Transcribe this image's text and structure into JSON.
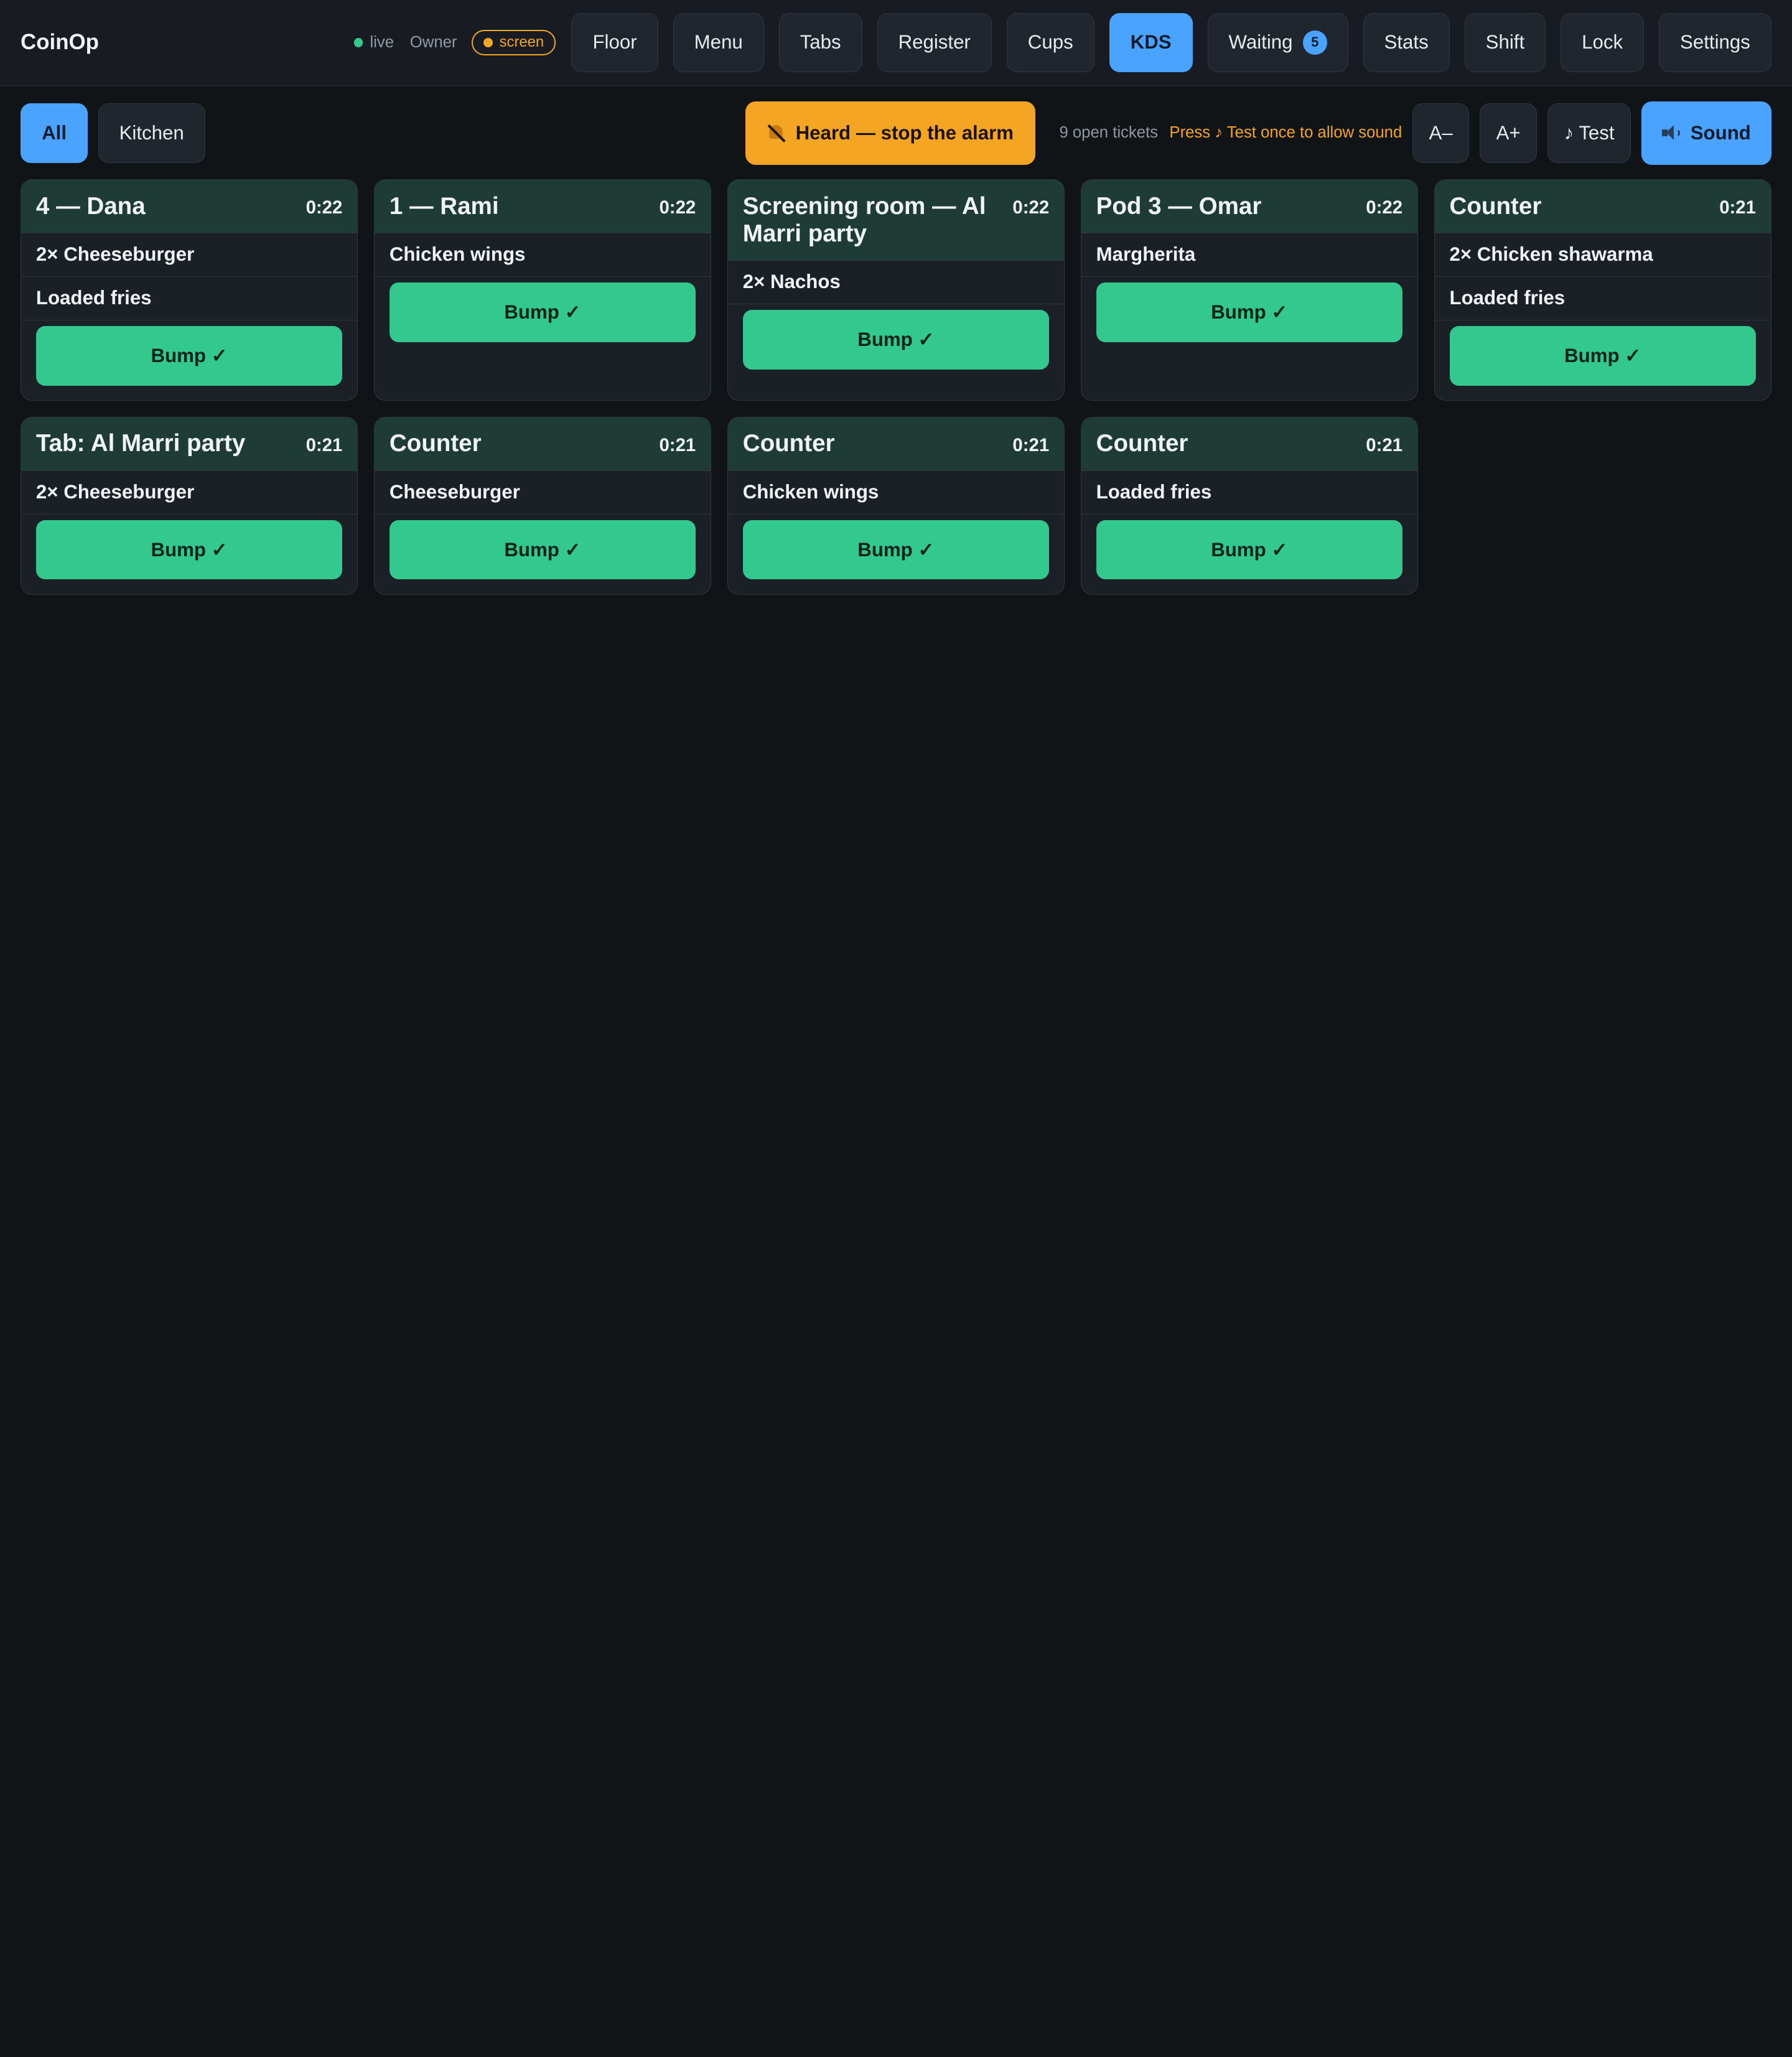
{
  "brand": "CoinOp",
  "status": {
    "live_label": "live",
    "role": "Owner",
    "mode_label": "screen"
  },
  "nav": [
    {
      "label": "Floor",
      "active": false
    },
    {
      "label": "Menu",
      "active": false
    },
    {
      "label": "Tabs",
      "active": false
    },
    {
      "label": "Register",
      "active": false
    },
    {
      "label": "Cups",
      "active": false
    },
    {
      "label": "KDS",
      "active": true
    },
    {
      "label": "Waiting",
      "active": false,
      "badge": "5"
    },
    {
      "label": "Stats",
      "active": false
    },
    {
      "label": "Shift",
      "active": false
    },
    {
      "label": "Lock",
      "active": false
    },
    {
      "label": "Settings",
      "active": false
    }
  ],
  "filters": [
    {
      "label": "All",
      "active": true
    },
    {
      "label": "Kitchen",
      "active": false
    }
  ],
  "toolbar": {
    "alarm_label": "Heard — stop the alarm",
    "open_tickets": "9 open tickets",
    "sound_hint": "Press ♪ Test once to allow sound",
    "font_down": "A–",
    "font_up": "A+",
    "test_label": "♪ Test",
    "sound_label": "Sound"
  },
  "bump_label": "Bump ✓",
  "tickets": [
    {
      "title": "4 — Dana",
      "timer": "0:22",
      "items": [
        "2× Cheeseburger",
        "Loaded fries"
      ]
    },
    {
      "title": "1 — Rami",
      "timer": "0:22",
      "items": [
        "Chicken wings"
      ]
    },
    {
      "title": "Screening room — Al Marri party",
      "timer": "0:22",
      "items": [
        "2× Nachos"
      ]
    },
    {
      "title": "Pod 3 — Omar",
      "timer": "0:22",
      "items": [
        "Margherita"
      ]
    },
    {
      "title": "Counter",
      "timer": "0:21",
      "items": [
        "2× Chicken shawarma",
        "Loaded fries"
      ]
    },
    {
      "title": "Tab: Al Marri party",
      "timer": "0:21",
      "items": [
        "2× Cheeseburger"
      ]
    },
    {
      "title": "Counter",
      "timer": "0:21",
      "items": [
        "Cheeseburger"
      ]
    },
    {
      "title": "Counter",
      "timer": "0:21",
      "items": [
        "Chicken wings"
      ]
    },
    {
      "title": "Counter",
      "timer": "0:21",
      "items": [
        "Loaded fries"
      ]
    }
  ],
  "colors": {
    "accent": "#4aa3ff",
    "alarm": "#f5a524",
    "bump": "#33c98e",
    "ticket_header": "#1e3b36",
    "background": "#111417"
  },
  "icons": {
    "alarm": "bell-off-icon",
    "sound": "speaker-icon",
    "live": "live-dot-icon"
  }
}
